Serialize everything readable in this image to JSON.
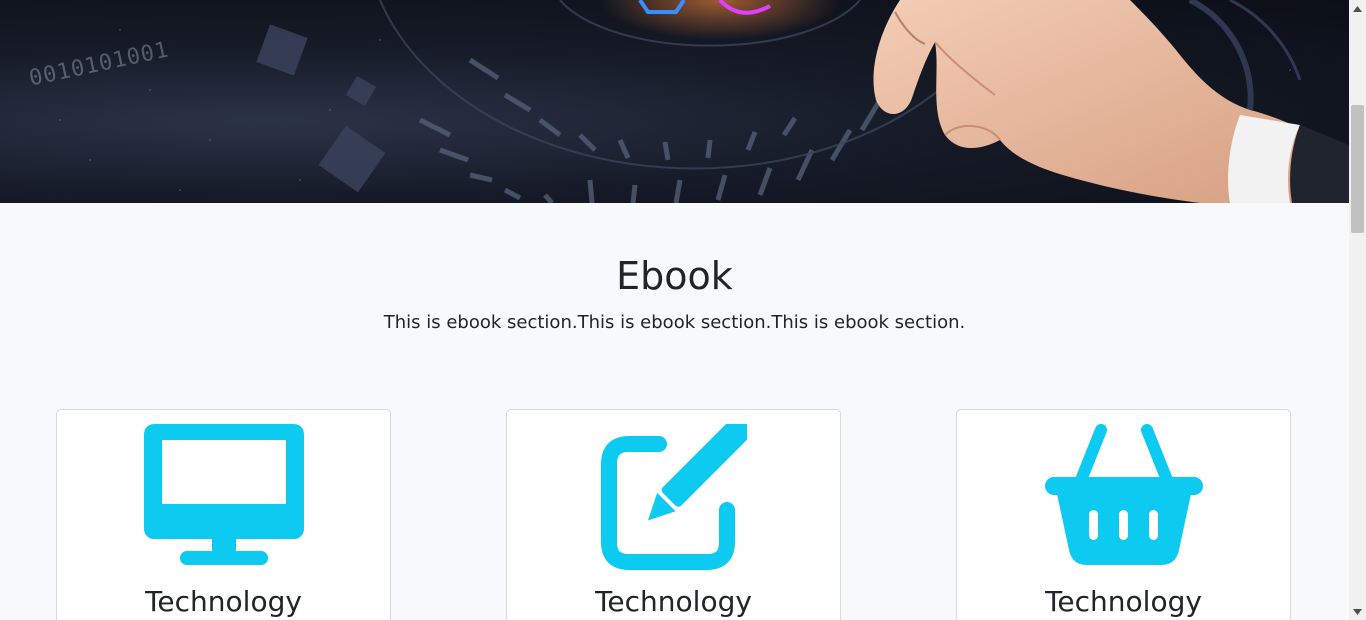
{
  "hero": {
    "binary_text": "0010101001"
  },
  "ebook": {
    "title": "Ebook",
    "subtitle": "This is ebook section.This is ebook section.This is ebook section."
  },
  "cards": [
    {
      "icon": "desktop-monitor-icon",
      "title": "Technology"
    },
    {
      "icon": "edit-pencil-icon",
      "title": "Technology"
    },
    {
      "icon": "shopping-basket-icon",
      "title": "Technology"
    }
  ],
  "colors": {
    "accent": "#0dcaf0",
    "background": "#f8f9fa",
    "card": "#ffffff"
  }
}
